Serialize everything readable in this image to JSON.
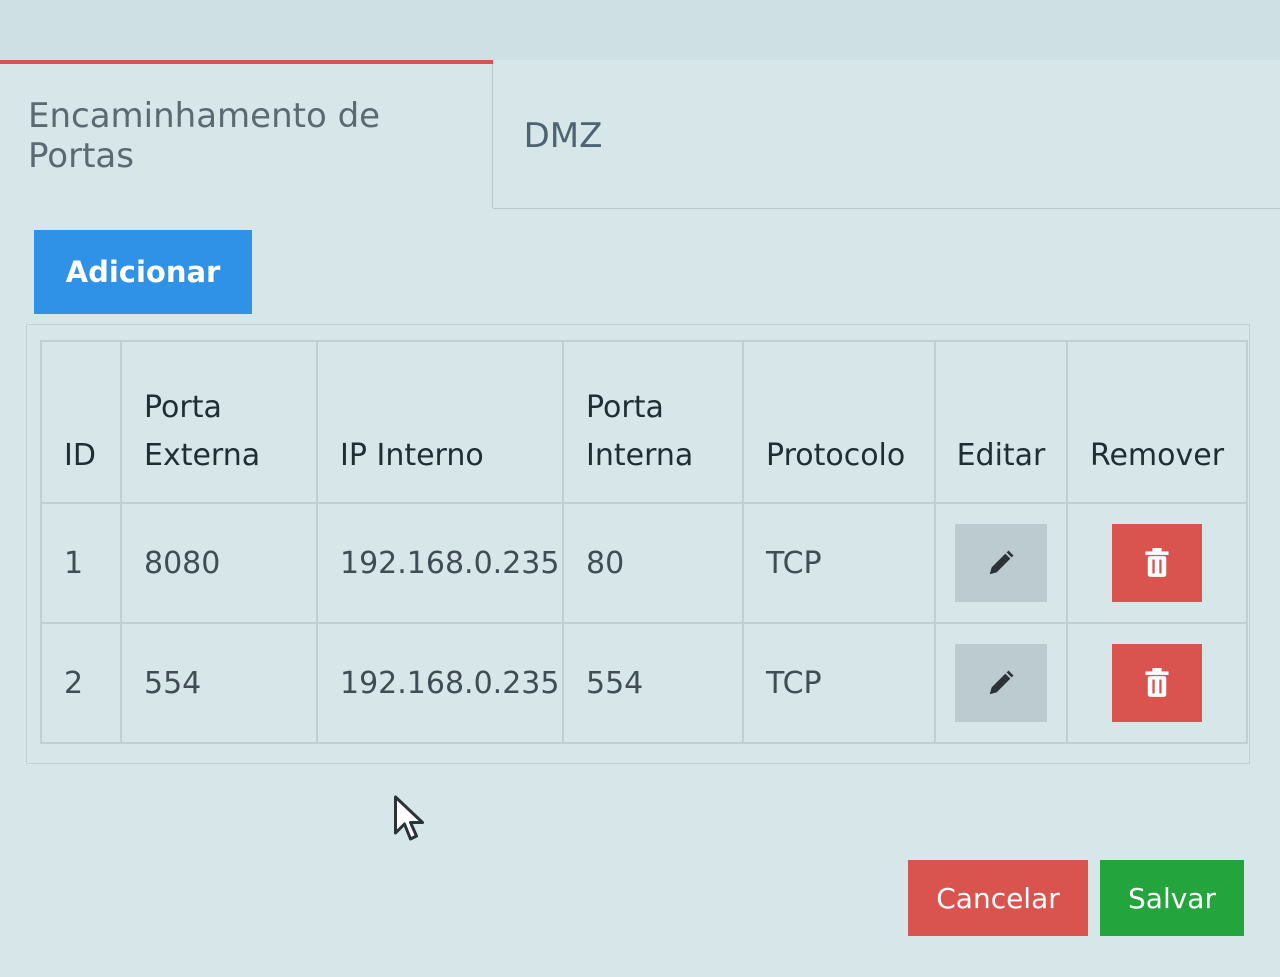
{
  "tabs": [
    {
      "label": "Encaminhamento de Portas",
      "active": true
    },
    {
      "label": "DMZ",
      "active": false
    }
  ],
  "toolbar": {
    "add_label": "Adicionar"
  },
  "table": {
    "headers": {
      "id": "ID",
      "external_port": "Porta Externa",
      "internal_ip": "IP Interno",
      "internal_port": "Porta Interna",
      "protocol": "Protocolo",
      "edit": "Editar",
      "remove": "Remover"
    },
    "rows": [
      {
        "id": "1",
        "external_port": "8080",
        "internal_ip": "192.168.0.235",
        "internal_port": "80",
        "protocol": "TCP"
      },
      {
        "id": "2",
        "external_port": "554",
        "internal_ip": "192.168.0.235",
        "internal_port": "554",
        "protocol": "TCP"
      }
    ]
  },
  "footer": {
    "cancel_label": "Cancelar",
    "save_label": "Salvar"
  },
  "icons": {
    "edit": "pencil-icon",
    "remove": "trash-icon",
    "cursor": "mouse-pointer-icon"
  },
  "colors": {
    "tab_accent": "#d9534f",
    "add_button": "#2f92e6",
    "danger": "#d9534f",
    "success": "#23a43c",
    "edit_button": "#bccbcf"
  }
}
